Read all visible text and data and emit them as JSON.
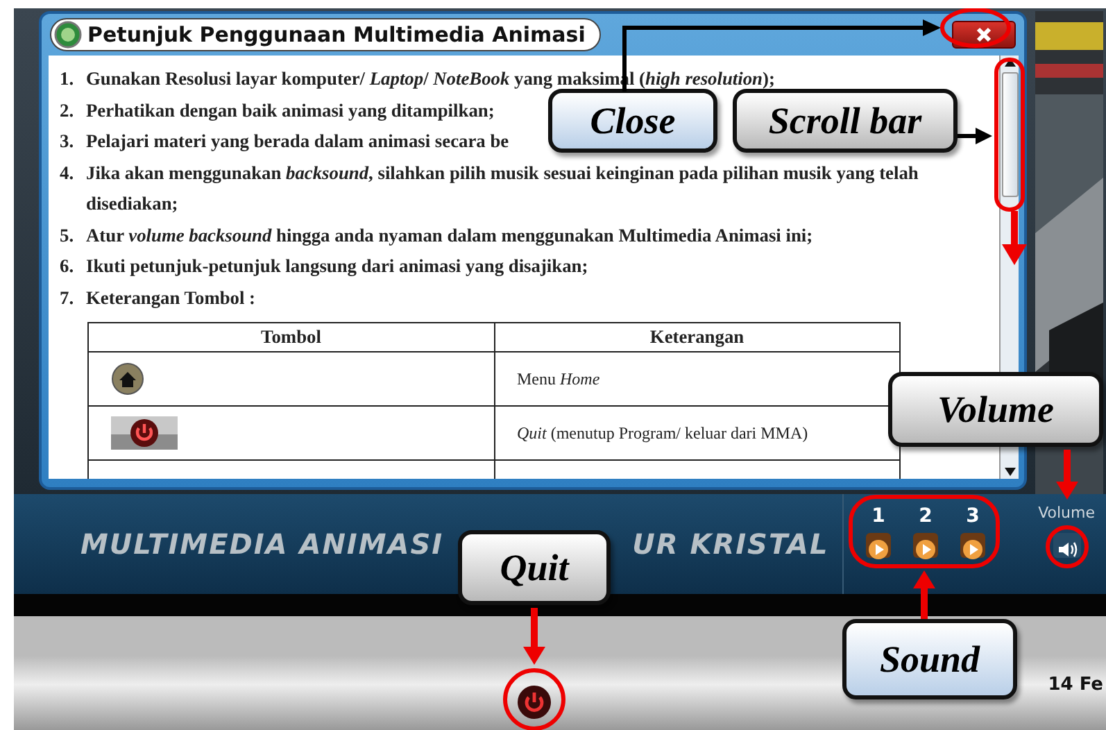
{
  "dialog": {
    "title": "Petunjuk Penggunaan Multimedia Animasi",
    "instructions": [
      {
        "number": "1.",
        "text": "Gunakan Resolusi layar komputer/ *Laptop*/ *NoteBook* yang maksimal (*high resolution*);"
      },
      {
        "number": "2.",
        "text": "Perhatikan dengan baik animasi yang ditampilkan;"
      },
      {
        "number": "3.",
        "text": "Pelajari  materi yang berada dalam animasi secara be"
      },
      {
        "number": "4.",
        "text": "Jika akan menggunakan *backsound*, silahkan pilih musik sesuai keinginan pada pilihan musik yang telah disediakan;"
      },
      {
        "number": "5.",
        "text": "Atur *volume backsound* hingga anda nyaman dalam menggunakan Multimedia Animasi ini;"
      },
      {
        "number": "6.",
        "text": "Ikuti petunjuk-petunjuk langsung dari animasi yang disajikan;"
      },
      {
        "number": "7.",
        "text": "Keterangan Tombol :"
      }
    ],
    "table": {
      "columns": [
        "Tombol",
        "Keterangan"
      ],
      "rows": [
        {
          "kind": "home",
          "description": "Menu  *Home*"
        },
        {
          "kind": "quit",
          "description": "*Quit* (menutup Program/ keluar dari MMA)"
        }
      ]
    }
  },
  "banner": {
    "title_left": "MULTIMEDIA ANIMASI",
    "title_right": "UR KRISTAL"
  },
  "sound": {
    "tracks": [
      {
        "label": "1"
      },
      {
        "label": "2"
      },
      {
        "label": "3"
      }
    ],
    "volume_label": "Volume"
  },
  "footer": {
    "date_fragment": "14 Fe"
  },
  "callouts": [
    {
      "label": "Close"
    },
    {
      "label": "Scroll bar"
    },
    {
      "label": "Volume"
    },
    {
      "label": "Quit"
    },
    {
      "label": "Sound"
    }
  ]
}
